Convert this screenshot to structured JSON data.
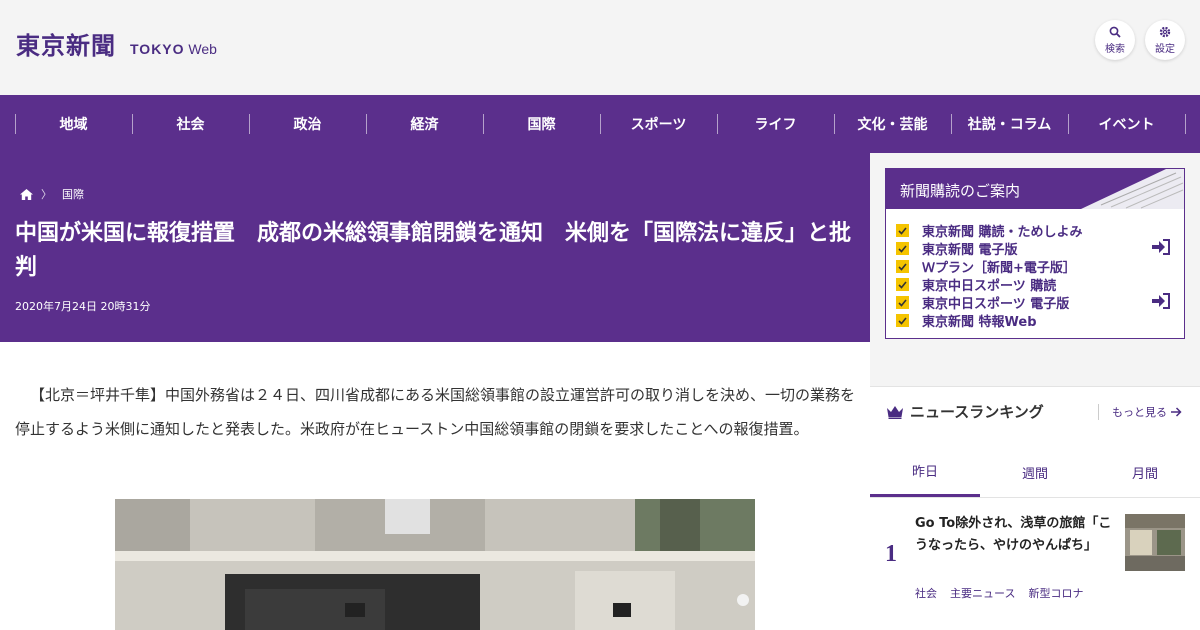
{
  "header": {
    "logo_kanji": "東京新聞",
    "logo_tokyo": "TOKYO",
    "logo_web": "Web",
    "search_label": "検索",
    "settings_label": "設定"
  },
  "nav": {
    "items": [
      "地域",
      "社会",
      "政治",
      "経済",
      "国際",
      "スポーツ",
      "ライフ",
      "文化・芸能",
      "社説・コラム",
      "イベント"
    ]
  },
  "article": {
    "breadcrumb_category": "国際",
    "title": "中国が米国に報復措置　成都の米総領事館閉鎖を通知　米側を「国際法に違反」と批判",
    "date": "2020年7月24日 20時31分",
    "body": "【北京＝坪井千隼】中国外務省は２４日、四川省成都にある米国総領事館の設立運営許可の取り消しを決め、一切の業務を停止するよう米側に通知したと発表した。米政府が在ヒューストン中国総領事館の閉鎖を要求したことへの報復措置。"
  },
  "subscription": {
    "title": "新聞購読のご案内",
    "items": [
      "東京新聞 購読・ためしよみ",
      "東京新聞 電子版",
      "Ｗプラン［新聞+電子版］",
      "東京中日スポーツ 購読",
      "東京中日スポーツ 電子版",
      "東京新聞 特報Web"
    ]
  },
  "ranking": {
    "title": "ニュースランキング",
    "more": "もっと見る",
    "tabs": [
      "昨日",
      "週間",
      "月間"
    ],
    "first": {
      "rank": "1",
      "title": "Go To除外され、浅草の旅館「こうなったら、やけのやんぱち」",
      "tags": [
        "社会",
        "主要ニュース",
        "新型コロナ"
      ]
    }
  },
  "colors": {
    "brand_purple": "#5b2f8c",
    "accent_yellow": "#f5c400",
    "header_bg": "#f4f4f4"
  }
}
